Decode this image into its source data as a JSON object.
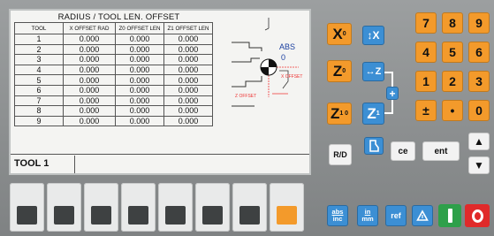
{
  "table": {
    "title": "RADIUS / TOOL LEN. OFFSET",
    "headers": [
      "TOOL",
      "X OFFSET RAD",
      "Z0 OFFSET LEN",
      "Z1 OFFSET LEN"
    ],
    "rows": [
      [
        "1",
        "0.000",
        "0.000",
        "0.000"
      ],
      [
        "2",
        "0.000",
        "0.000",
        "0.000"
      ],
      [
        "3",
        "0.000",
        "0.000",
        "0.000"
      ],
      [
        "4",
        "0.000",
        "0.000",
        "0.000"
      ],
      [
        "5",
        "0.000",
        "0.000",
        "0.000"
      ],
      [
        "6",
        "0.000",
        "0.000",
        "0.000"
      ],
      [
        "7",
        "0.000",
        "0.000",
        "0.000"
      ],
      [
        "8",
        "0.000",
        "0.000",
        "0.000"
      ],
      [
        "9",
        "0.000",
        "0.000",
        "0.000"
      ]
    ]
  },
  "diagram": {
    "mode": "ABS",
    "value": "0",
    "x_offset_label": "X OFFSET",
    "z_offset_label": "Z OFFSET"
  },
  "status": {
    "tool_label": "TOOL",
    "tool_number": "1"
  },
  "keys": {
    "x_axis": "X",
    "x_sub": "0",
    "z0_axis": "Z",
    "z0_sub": "0",
    "z10_axis": "Z",
    "z10_sub": "1 0",
    "x_jog": "↕X",
    "z_jog": "↔Z",
    "z1": "Z",
    "z1_sub": "1",
    "plus": "+",
    "r_d": "R/D",
    "ce": "ce",
    "ent": "ent",
    "up": "▲",
    "down": "▼",
    "abs_inc_top": "abs",
    "abs_inc_bottom": "inc",
    "in_mm_top": "in",
    "in_mm_bottom": "mm",
    "ref": "ref",
    "digits": [
      "7",
      "8",
      "9",
      "4",
      "5",
      "6",
      "1",
      "2",
      "3",
      "±",
      "•",
      "0"
    ]
  },
  "colors": {
    "axis_key": "#f39a2b",
    "blue_key": "#3c8fd4",
    "on": "#2ea04a",
    "off": "#e02a2a"
  },
  "icons": [
    "x-jog-icon",
    "z-jog-icon",
    "tool-icon",
    "delta-icon",
    "up-arrow-icon",
    "down-arrow-icon",
    "power-on-icon",
    "power-off-icon"
  ]
}
